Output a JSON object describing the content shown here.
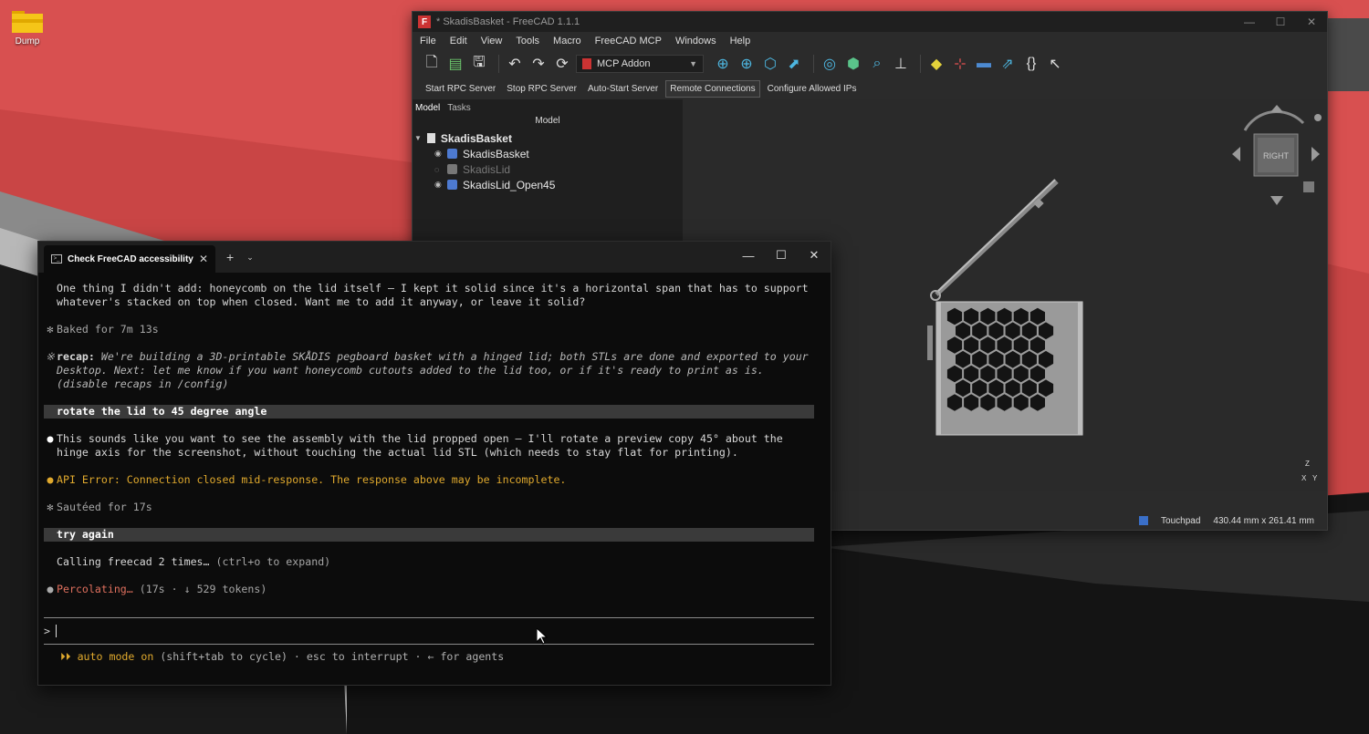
{
  "desktop": {
    "icon_label": "Dump"
  },
  "freecad": {
    "title": "* SkadisBasket - FreeCAD 1.1.1",
    "menu": [
      "File",
      "Edit",
      "View",
      "Tools",
      "Macro",
      "FreeCAD MCP",
      "Windows",
      "Help"
    ],
    "workbench": "MCP Addon",
    "rpc_buttons": [
      "Start RPC Server",
      "Stop RPC Server",
      "Auto-Start Server",
      "Remote Connections",
      "Configure Allowed IPs"
    ],
    "tree_tabs": [
      "Model",
      "Tasks"
    ],
    "tree_header": "Model",
    "tree": {
      "document": "SkadisBasket",
      "items": [
        "SkadisBasket",
        "SkadisLid",
        "SkadisLid_Open45"
      ]
    },
    "navcube_face": "RIGHT",
    "axis_labels": [
      "Z",
      "X",
      "Y"
    ],
    "status": {
      "nav_style": "Touchpad",
      "dimensions": "430.44 mm x 261.41 mm"
    },
    "accent_color": "#3a6fc8"
  },
  "terminal": {
    "tab_label": "Check FreeCAD accessibility",
    "lines": {
      "l1": "One thing I didn't add: honeycomb on the lid itself — I kept it solid since it's a horizontal span that has to support whatever's stacked on top when closed. Want me to add it anyway, or leave it solid?",
      "baked": "Baked for 7m 13s",
      "recap_label": "recap:",
      "recap_text": " We're building a 3D-printable SKÅDIS pegboard basket with a hinged lid; both STLs are done and exported to your Desktop. Next: let me know if you want honeycomb cutouts added to the lid too, or if it's ready to print as is. (disable recaps in /config)",
      "user1": "rotate the lid to 45 degree angle",
      "assistant1": "This sounds like you want to see the assembly with the lid propped open — I'll rotate a preview copy 45° about the hinge axis for the screenshot, without touching the actual lid STL (which needs to stay flat for printing).",
      "error": "API Error: Connection closed mid-response. The response above may be incomplete.",
      "sauteed": "Sautéed for 17s",
      "user2": "try again",
      "calling": "Calling freecad 2 times…",
      "calling_hint": " (ctrl+o to expand)",
      "perc": "Percolating…",
      "perc_hint": " (17s · ↓ 529 tokens)",
      "prompt": ">",
      "mode_on": "⏵⏵ auto mode on",
      "mode_hint": " (shift+tab to cycle) · esc to interrupt · ← for agents"
    },
    "colors": {
      "warning": "#e0a92d",
      "progress": "#e0705e"
    }
  }
}
